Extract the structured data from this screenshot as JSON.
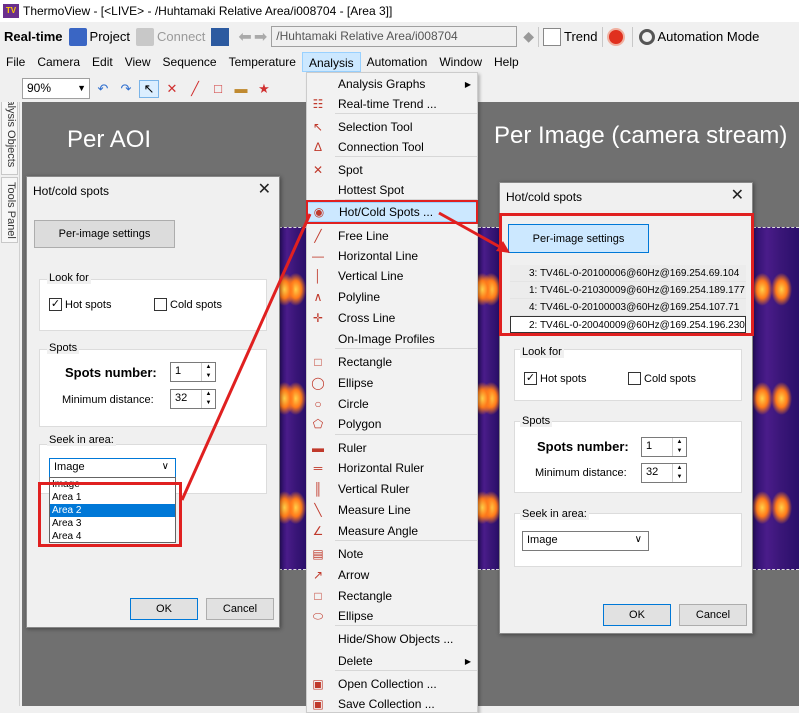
{
  "window": {
    "app_icon_text": "TV",
    "title": "ThermoView - [<LIVE> - /Huhtamaki Relative Area/i008704 - [Area 3]]"
  },
  "toolbar": {
    "realtime": "Real-time",
    "project": "Project",
    "connect": "Connect",
    "path": "/Huhtamaki Relative Area/i008704",
    "trend": "Trend",
    "automation_mode": "Automation Mode"
  },
  "menubar": [
    "File",
    "Camera",
    "Edit",
    "View",
    "Sequence",
    "Temperature",
    "Analysis",
    "Automation",
    "Window",
    "Help"
  ],
  "toolbar2": {
    "zoom": "90%"
  },
  "side_panel": {
    "tab1": "Analysis Objects",
    "tab2": "Tools Panel"
  },
  "annotations": {
    "left": "Per AOI",
    "right": "Per Image (camera stream)"
  },
  "analysis_menu": {
    "items": [
      {
        "label": "Analysis Graphs",
        "icon": "graph-icon",
        "submenu": true
      },
      {
        "label": "Real-time Trend ...",
        "icon": "trend-icon"
      },
      {
        "label": "Selection Tool",
        "icon": "cursor-icon"
      },
      {
        "label": "Connection Tool",
        "icon": "connection-icon"
      },
      {
        "label": "Spot",
        "icon": "spot-icon"
      },
      {
        "label": "Hottest Spot",
        "icon": "hottest-spot-icon"
      },
      {
        "label": "Hot/Cold Spots ...",
        "icon": "hot-cold-icon",
        "highlighted": true
      },
      {
        "label": "Free Line",
        "icon": "free-line-icon"
      },
      {
        "label": "Horizontal Line",
        "icon": "horizontal-line-icon"
      },
      {
        "label": "Vertical Line",
        "icon": "vertical-line-icon"
      },
      {
        "label": "Polyline",
        "icon": "polyline-icon"
      },
      {
        "label": "Cross Line",
        "icon": "cross-line-icon"
      },
      {
        "label": "On-Image Profiles",
        "icon": "profile-icon"
      },
      {
        "label": "Rectangle",
        "icon": "rectangle-icon"
      },
      {
        "label": "Ellipse",
        "icon": "ellipse-icon"
      },
      {
        "label": "Circle",
        "icon": "circle-icon"
      },
      {
        "label": "Polygon",
        "icon": "polygon-icon"
      },
      {
        "label": "Ruler",
        "icon": "ruler-icon"
      },
      {
        "label": "Horizontal Ruler",
        "icon": "horizontal-ruler-icon"
      },
      {
        "label": "Vertical Ruler",
        "icon": "vertical-ruler-icon"
      },
      {
        "label": "Measure Line",
        "icon": "measure-line-icon"
      },
      {
        "label": "Measure Angle",
        "icon": "measure-angle-icon"
      },
      {
        "label": "Note",
        "icon": "note-icon"
      },
      {
        "label": "Arrow",
        "icon": "arrow-icon"
      },
      {
        "label": "Rectangle",
        "icon": "rectangle-outline-icon"
      },
      {
        "label": "Ellipse",
        "icon": "ellipse-outline-icon"
      },
      {
        "label": "Hide/Show Objects ...",
        "icon": ""
      },
      {
        "label": "Delete",
        "icon": "",
        "submenu": true
      },
      {
        "label": "Open Collection ...",
        "icon": "open-collection-icon"
      },
      {
        "label": "Save Collection ...",
        "icon": "save-collection-icon"
      }
    ]
  },
  "dialog_left": {
    "title": "Hot/cold spots",
    "per_image_button": "Per-image settings",
    "look_for": "Look for",
    "hot_spots": "Hot spots",
    "cold_spots": "Cold spots",
    "spots_group": "Spots",
    "spots_number_label": "Spots number:",
    "spots_number_value": "1",
    "min_distance_label": "Minimum distance:",
    "min_distance_value": "32",
    "seek_in_area": "Seek in area:",
    "seek_value": "Image",
    "dropdown_options": [
      "Image",
      "Area 1",
      "Area 2",
      "Area 3",
      "Area 4"
    ],
    "ok": "OK",
    "cancel": "Cancel"
  },
  "dialog_right": {
    "title": "Hot/cold spots",
    "per_image_button": "Per-image settings",
    "cameras": [
      "3: TV46L-0-20100006@60Hz@169.254.69.104",
      "1: TV46L-0-21030009@60Hz@169.254.189.177",
      "4: TV46L-0-20100003@60Hz@169.254.107.71",
      "2: TV46L-0-20040009@60Hz@169.254.196.230"
    ],
    "look_for": "Look for",
    "hot_spots": "Hot spots",
    "cold_spots": "Cold spots",
    "spots_group": "Spots",
    "spots_number_label": "Spots number:",
    "spots_number_value": "1",
    "min_distance_label": "Minimum distance:",
    "min_distance_value": "32",
    "seek_in_area": "Seek in area:",
    "seek_value": "Image",
    "ok": "OK",
    "cancel": "Cancel"
  },
  "colors": {
    "highlight": "#cce8ff",
    "selection": "#0078d7",
    "annotation_red": "#e02020"
  }
}
